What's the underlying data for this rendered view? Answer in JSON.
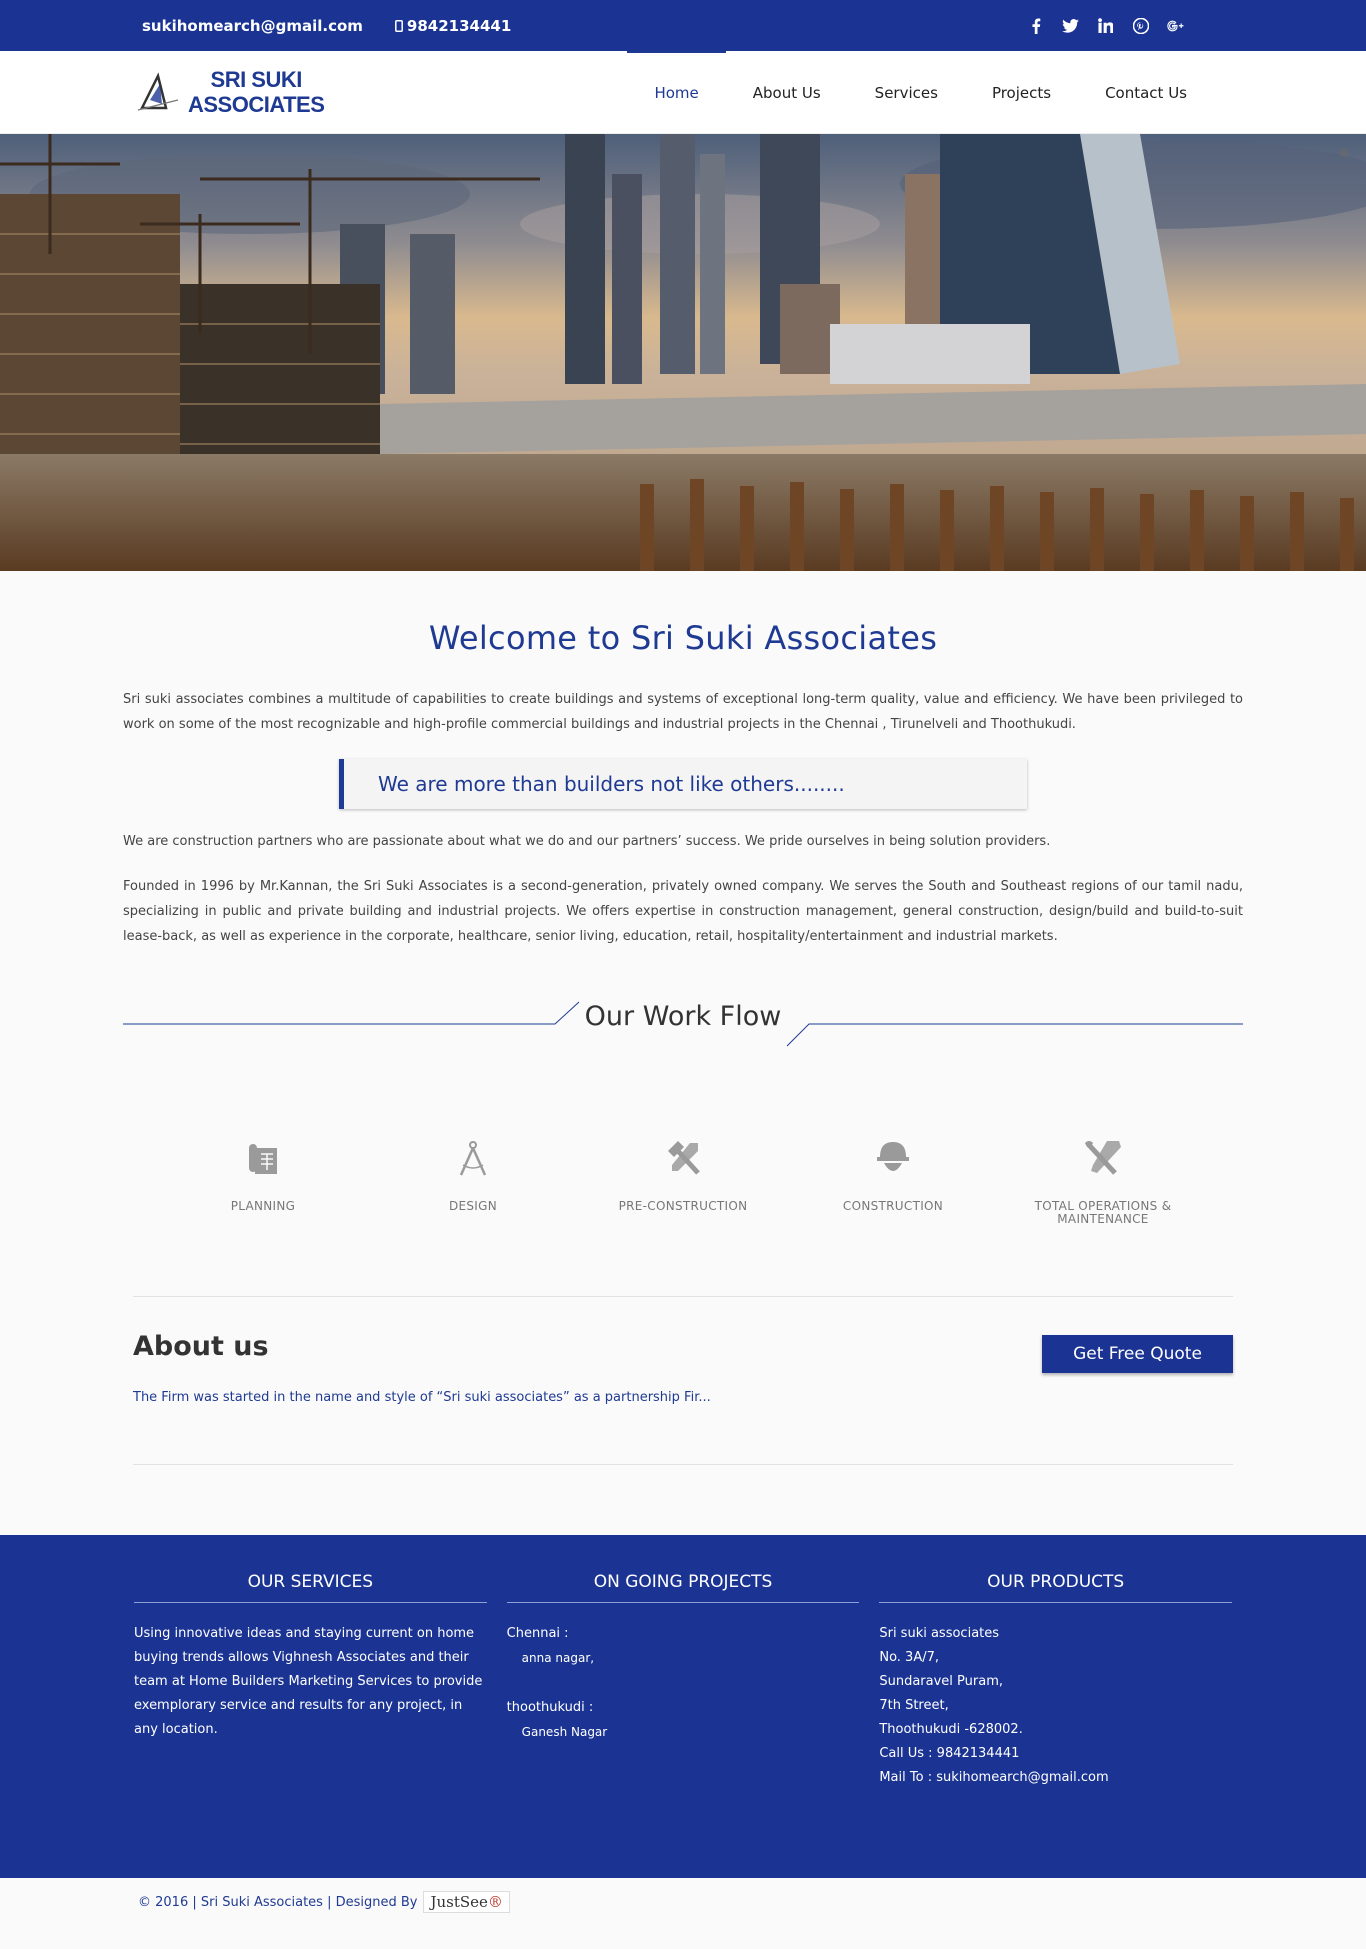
{
  "topbar": {
    "email": "sukihomearch@gmail.com",
    "phone": "9842134441",
    "social": [
      {
        "name": "facebook-icon",
        "glyph": "f"
      },
      {
        "name": "twitter-icon",
        "glyph": "t"
      },
      {
        "name": "linkedin-icon",
        "glyph": "in"
      },
      {
        "name": "pinterest-icon",
        "glyph": "p"
      },
      {
        "name": "google-plus-icon",
        "glyph": "g+"
      }
    ]
  },
  "header": {
    "logo_line1": "SRI SUKI",
    "logo_line2": "ASSOCIATES",
    "nav": [
      "Home",
      "About Us",
      "Services",
      "Projects",
      "Contact Us"
    ],
    "active_nav": "Home"
  },
  "welcome": {
    "title": "Welcome to Sri Suki Associates",
    "intro": "Sri suki associates combines a multitude of capabilities to create buildings and systems of exceptional long-term quality, value and efficiency. We have been privileged to work on some of the most recognizable and high-profile commercial buildings and industrial projects in the Chennai , Tirunelveli and Thoothukudi.",
    "quote": "We are more than builders not like others........",
    "partners": "We are construction partners who are passionate about what we do and our partners’ success. We pride ourselves in being solution providers.",
    "founded": "Founded in 1996 by Mr.Kannan, the Sri Suki Associates  is a second-generation, privately owned company. We serves the South and Southeast regions of our tamil nadu, specializing in public and private building and industrial projects. We offers expertise in construction management, general construction, design/build and build-to-suit lease-back, as well as experience in the corporate, healthcare, senior living, education, retail, hospitality/entertainment and industrial markets."
  },
  "workflow": {
    "title": "Our Work Flow",
    "steps": [
      {
        "label": "PLANNING",
        "icon": "blueprint-icon"
      },
      {
        "label": "DESIGN",
        "icon": "compass-icon"
      },
      {
        "label": "PRE-CONSTRUCTION",
        "icon": "hammer-icon"
      },
      {
        "label": "CONSTRUCTION",
        "icon": "hard-hat-icon"
      },
      {
        "label": "TOTAL OPERATIONS & MAINTENANCE",
        "icon": "tools-icon"
      }
    ]
  },
  "about": {
    "title": "About us",
    "text": "The Firm was started in the name and style of “Sri suki associates” as a partnership Fir...",
    "button": "Get Free Quote"
  },
  "footer": {
    "services_title": "OUR SERVICES",
    "services_text": "Using innovative ideas and staying current on home buying trends allows Vighnesh Associates and their team at Home Builders Marketing Services to provide exemplorary service and results for any project, in any location.",
    "projects_title": "ON GOING PROJECTS",
    "projects": [
      {
        "city": "Chennai :",
        "area": "anna nagar,"
      },
      {
        "city": "thoothukudi :",
        "area": "Ganesh Nagar"
      }
    ],
    "products_title": "OUR PRODUCTS",
    "address": [
      "Sri suki associates",
      "No. 3A/7,",
      "Sundaravel Puram,",
      "7th Street,",
      "Thoothukudi -628002.",
      "Call Us  : 9842134441",
      "Mail To : sukihomearch@gmail.com"
    ]
  },
  "copyright": {
    "text": "© 2016 | Sri Suki Associates | Designed By",
    "brand": "JustSee"
  },
  "colors": {
    "brand": "#1b3493",
    "accent": "#1f3a93"
  }
}
